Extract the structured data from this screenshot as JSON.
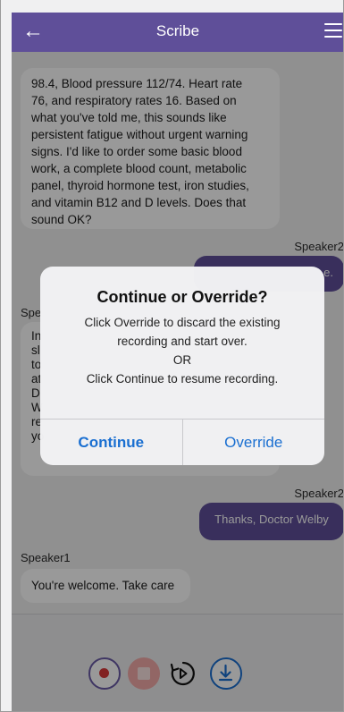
{
  "header": {
    "title": "Scribe",
    "back_icon": "arrow-left-icon",
    "menu_icon": "hamburger-menu-icon"
  },
  "messages": [
    {
      "type": "incoming",
      "lines": [
        "98.4, Blood pressure 112/74. Heart rate",
        "76, and respiratory rates 16. Based on",
        "what you've told me, this sounds like",
        "persistent fatigue without urgent warning",
        "signs. I'd like to order some basic blood",
        "work, a complete blood count, metabolic",
        "panel, thyroid hormone test, iron studies,",
        "and vitamin B12 and D levels. Does that",
        "sound OK?"
      ]
    },
    {
      "type": "outgoing",
      "speaker": "Speaker2",
      "text": "e."
    },
    {
      "type": "incoming",
      "speaker": "Spe",
      "lines": [
        "In",
        "sl",
        "to",
        "at",
        "D",
        "W",
        "re",
        "yo"
      ]
    },
    {
      "type": "outgoing",
      "speaker": "Speaker2",
      "text": "Thanks, Doctor Welby"
    },
    {
      "type": "incoming",
      "speaker": "Speaker1",
      "text": "You're welcome. Take care"
    }
  ],
  "dialog": {
    "title": "Continue or Override?",
    "message_lines": [
      "Click Override to discard the existing",
      "recording and start over.",
      "OR",
      "Click Continue to resume recording."
    ],
    "continue_label": "Continue",
    "override_label": "Override"
  },
  "controls": {
    "record_icon": "record-icon",
    "stop_icon": "stop-icon",
    "replay_icon": "replay-5-icon",
    "download_icon": "download-icon"
  },
  "colors": {
    "brand": "#5f4f99",
    "link": "#1a6fd1",
    "record": "#d93a3a",
    "stop": "#f4aaa8"
  }
}
